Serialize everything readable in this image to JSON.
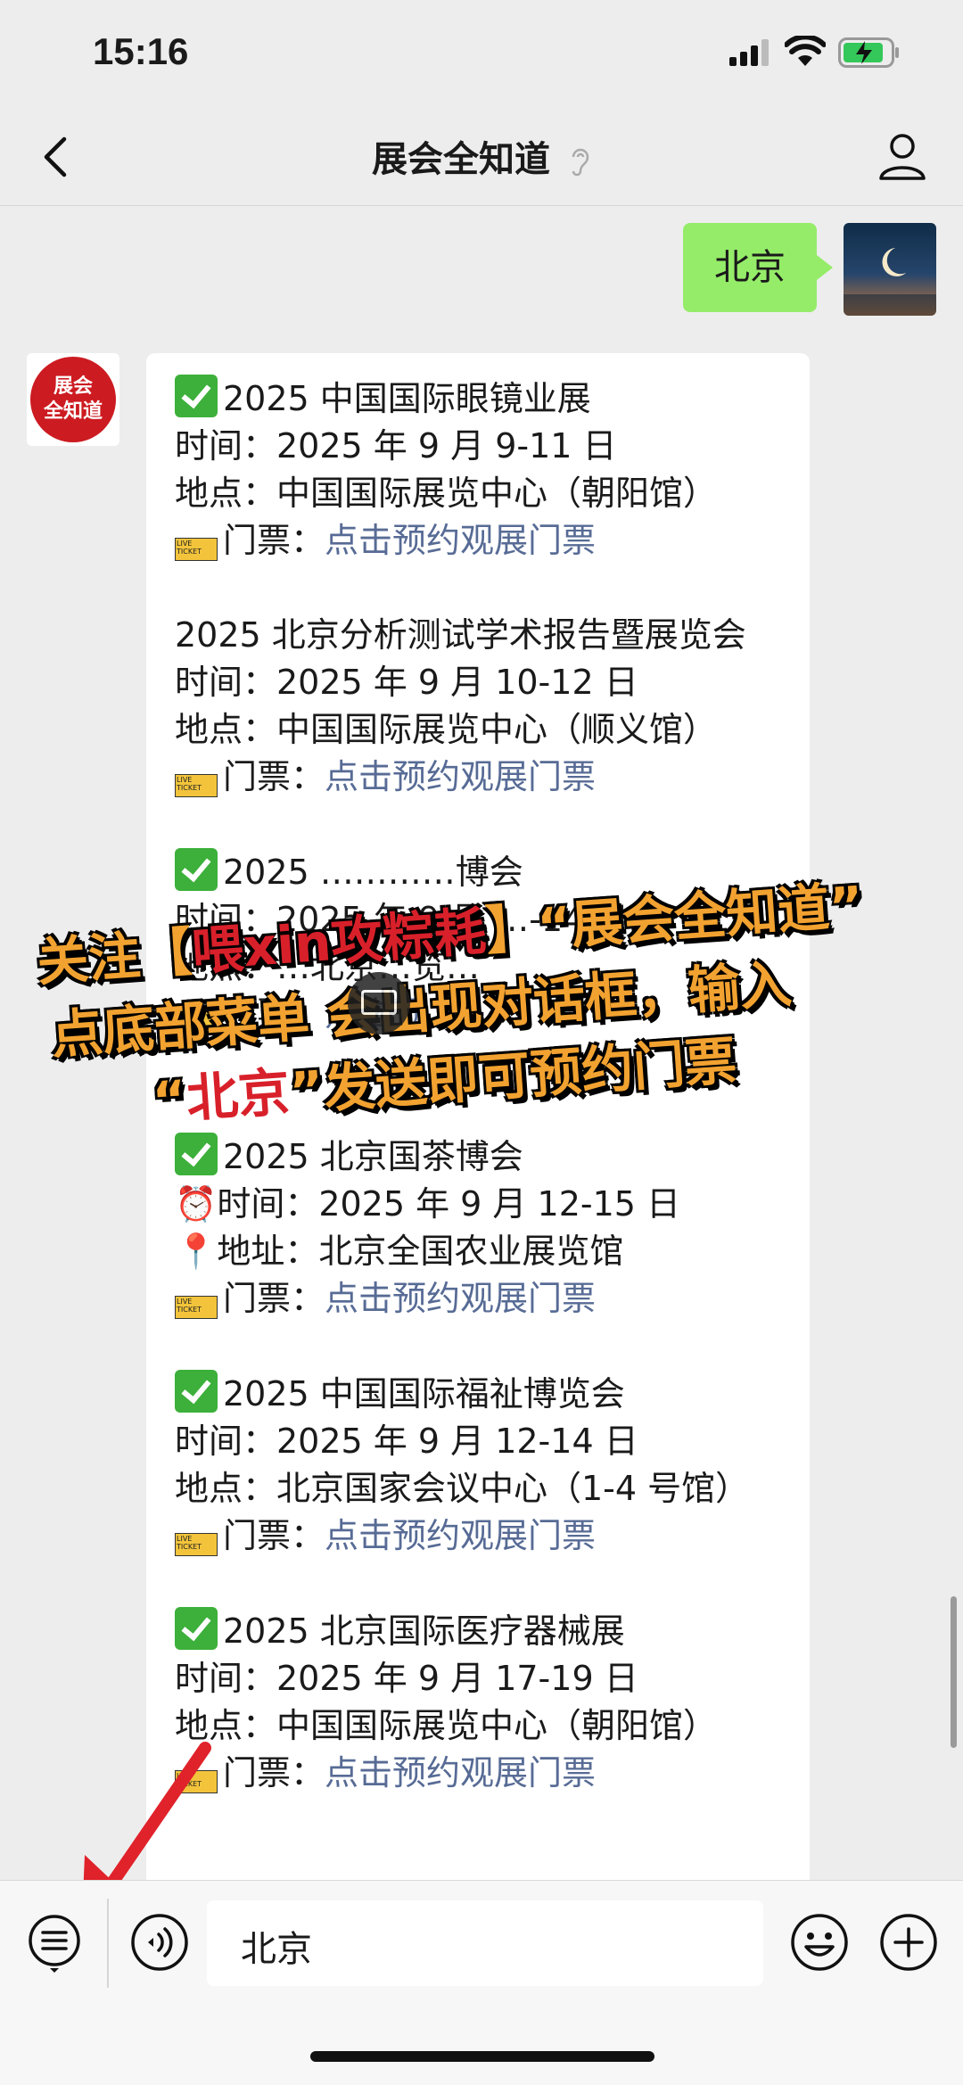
{
  "status": {
    "time": "15:16"
  },
  "nav": {
    "title": "展会全知道"
  },
  "sent_message": "北京",
  "brand": {
    "avatar_line1": "展会",
    "avatar_line2": "全知道"
  },
  "entries": [
    {
      "title": "2025 中国国际眼镜业展",
      "check": true,
      "lines": [
        "时间：2025 年 9 月 9-11 日",
        "地点：中国国际展览中心（朝阳馆）"
      ],
      "ticket_label": "门票：",
      "ticket_link": "点击预约观展门票"
    },
    {
      "title": "2025 北京分析测试学术报告暨展览会",
      "check": false,
      "lines": [
        "时间：2025 年 9 月 10-12 日",
        "地点：中国国际展览中心（顺义馆）"
      ],
      "ticket_label": "门票：",
      "ticket_link": "点击预约观展门票"
    },
    {
      "title": "2025 …………博会",
      "check": true,
      "lines": [
        "时间：2025 年 9 月 …-14 日",
        "地点：…北京…览…"
      ],
      "ticket_label": "门票：",
      "ticket_link": "点击预……"
    },
    {
      "title": "2025 北京国茶博会",
      "check": true,
      "lines": [
        "⏰时间：2025 年 9 月 12-15 日",
        "📍地址：北京全国农业展览馆"
      ],
      "ticket_label": "门票：",
      "ticket_link": "点击预约观展门票"
    },
    {
      "title": "2025 中国国际福祉博览会",
      "check": true,
      "lines": [
        "时间：2025 年 9 月 12-14 日",
        "地点：北京国家会议中心（1-4 号馆）"
      ],
      "ticket_label": "门票：",
      "ticket_link": "点击预约观展门票"
    },
    {
      "title": "2025 北京国际医疗器械展",
      "check": true,
      "lines": [
        "时间：2025 年 9 月 17-19 日",
        "地点：中国国际展览中心（朝阳馆）"
      ],
      "ticket_label": "门票：",
      "ticket_link": "点击预约观展门票"
    }
  ],
  "overlay": {
    "line1_a": "关注【",
    "line1_b": "喂xin攻粽耗",
    "line1_c": "】“展会全知道”",
    "line2": "点底部菜单  会出现对话框，输入",
    "line3_a": "“",
    "line3_b": "北京",
    "line3_c": "”发送即可预约门票"
  },
  "input": {
    "value": "北京"
  }
}
